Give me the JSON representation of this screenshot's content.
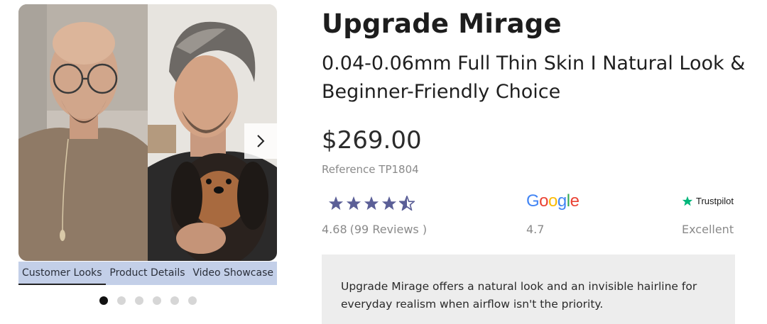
{
  "gallery": {
    "tabs": [
      {
        "label": "Customer Looks",
        "active": true
      },
      {
        "label": "Product Details",
        "active": false
      },
      {
        "label": "Video Showcase",
        "active": false
      }
    ],
    "dot_count": 6,
    "active_dot": 0,
    "next_icon": "chevron-right-icon"
  },
  "product": {
    "title": "Upgrade Mirage",
    "subtitle": "0.04-0.06mm Full Thin Skin I Natural Look & Beginner-Friendly Choice",
    "price": "$269.00",
    "reference": "Reference TP1804"
  },
  "ratings": {
    "site": {
      "stars_value": 4.68,
      "score": "4.68",
      "reviews": "(99 Reviews )",
      "star_color": "#5b5f97"
    },
    "google": {
      "logo": "Google",
      "score": "4.7"
    },
    "trustpilot": {
      "logo": "Trustpilot",
      "label": "Excellent",
      "star_color": "#00b67a"
    }
  },
  "description": "Upgrade Mirage offers a natural look and an invisible hairline for everyday realism when airflow isn't the priority.",
  "colors": {
    "tab_bar": "#c3cfe8",
    "description_bg": "#ededed"
  }
}
